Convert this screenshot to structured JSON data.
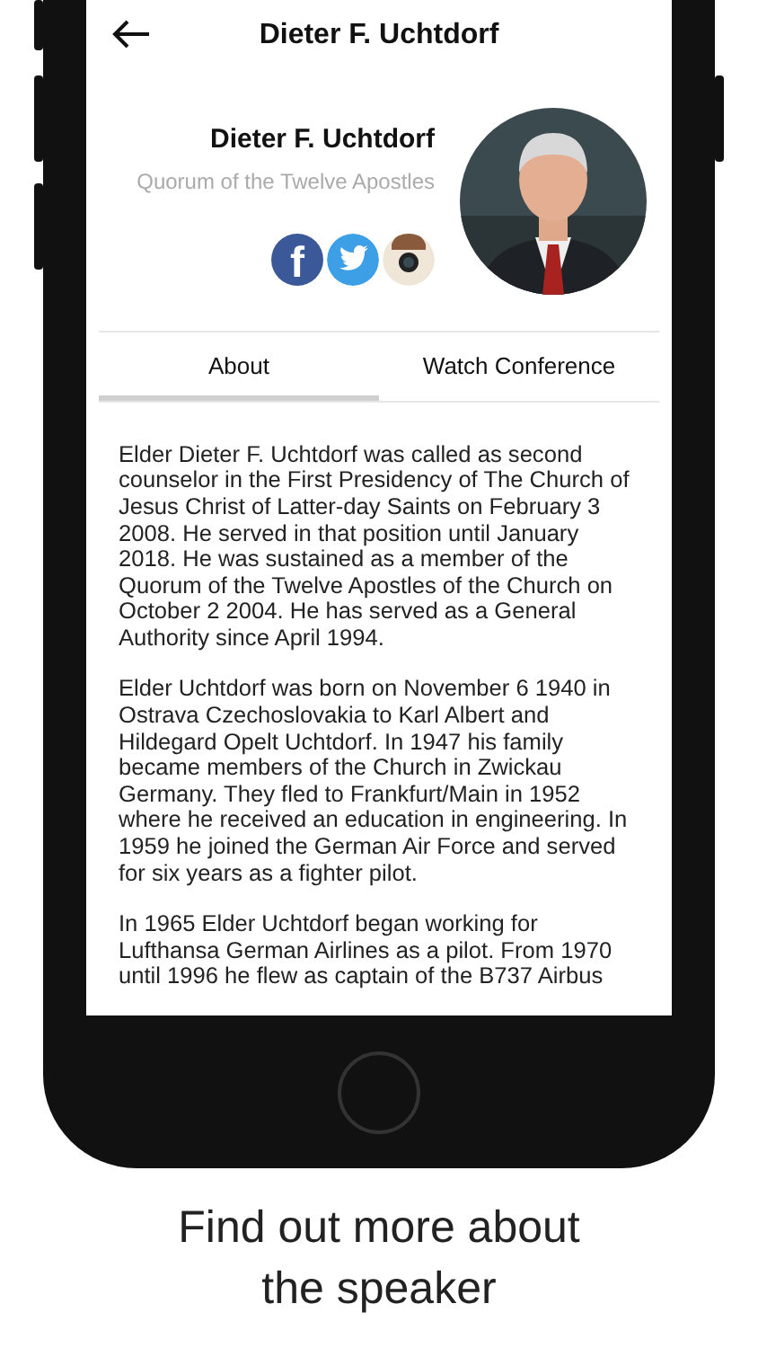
{
  "header": {
    "title": "Dieter F. Uchtdorf"
  },
  "profile": {
    "name": "Dieter F. Uchtdorf",
    "subtitle": "Quorum of the Twelve Apostles",
    "social": [
      {
        "kind": "facebook",
        "label": "f"
      },
      {
        "kind": "twitter"
      },
      {
        "kind": "instagram"
      }
    ]
  },
  "tabs": [
    {
      "label": "About",
      "selected": true
    },
    {
      "label": "Watch Conference",
      "selected": false
    }
  ],
  "paragraphs": [
    "Elder Dieter F. Uchtdorf was called as second counselor in the First Presidency of The Church of Jesus Christ of Latter-day Saints on February 3 2008. He served in that position until January 2018. He was sustained as a member of the Quorum of the Twelve Apostles of the Church on October 2 2004. He has served as a General Authority since April 1994.",
    "Elder Uchtdorf was born on November 6 1940 in Ostrava Czechoslovakia to Karl Albert and Hildegard Opelt Uchtdorf. In 1947 his family became members of the Church in Zwickau Germany. They fled to Frankfurt/Main in 1952 where he received an education in engineering. In 1959 he joined the German Air Force and served for six years as a fighter pilot.",
    "In 1965 Elder Uchtdorf began working for Lufthansa German Airlines as a pilot. From 1970 until 1996 he flew as captain of the B737 Airbus"
  ],
  "caption": [
    "Find out more about",
    "the speaker"
  ]
}
